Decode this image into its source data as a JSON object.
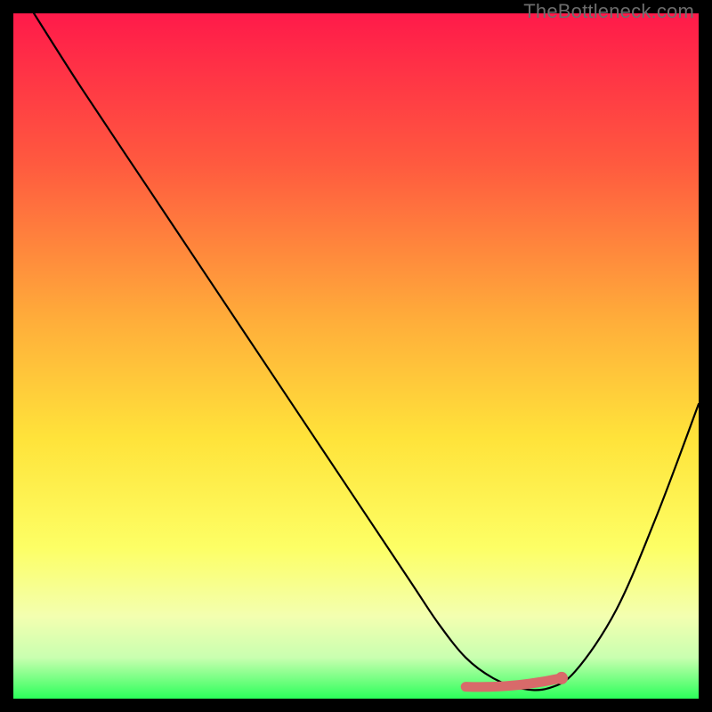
{
  "watermark": "TheBottleneck.com",
  "colors": {
    "bg": "#000000",
    "grad_top": "#ff1a4a",
    "grad_mid_upper": "#ff7a3a",
    "grad_mid": "#ffd83a",
    "grad_mid_lower": "#fff97a",
    "grad_low": "#e8ffc0",
    "grad_bottom": "#2bff5a",
    "curve": "#000000",
    "accent": "#d86a6a",
    "watermark": "#6d6d6d"
  },
  "chart_data": {
    "type": "line",
    "title": "",
    "xlabel": "",
    "ylabel": "",
    "xlim": [
      0,
      100
    ],
    "ylim": [
      0,
      100
    ],
    "series": [
      {
        "name": "bottleneck-curve",
        "x": [
          3,
          10,
          20,
          30,
          40,
          50,
          58,
          62,
          66,
          70,
          74,
          78,
          82,
          88,
          94,
          100
        ],
        "values": [
          100,
          89,
          74,
          59,
          44,
          29,
          17,
          11,
          6,
          3,
          1.5,
          1.5,
          4,
          13,
          27,
          43
        ]
      }
    ],
    "accent_segment": {
      "name": "optimal-range",
      "x_start": 66,
      "x_end": 80,
      "y": 2,
      "endpoint_y": 3
    }
  }
}
